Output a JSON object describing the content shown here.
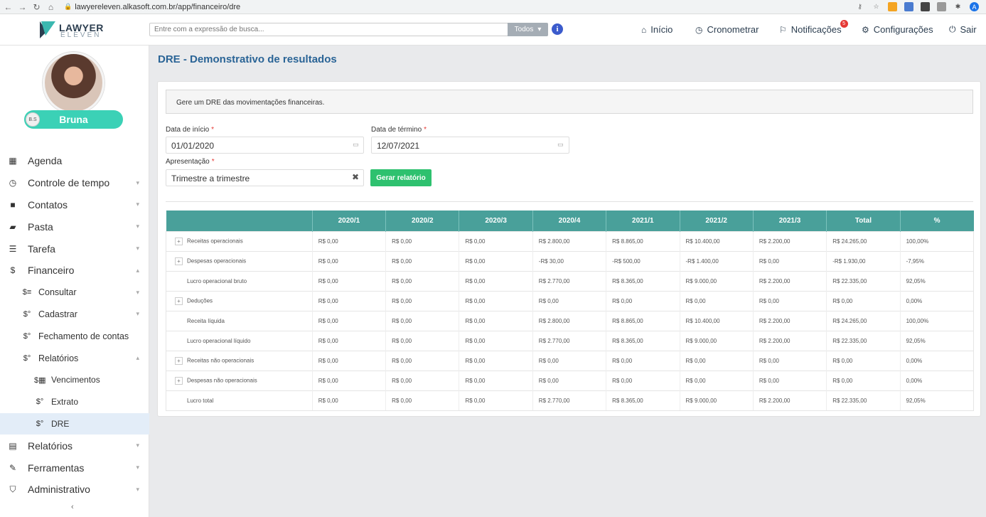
{
  "browser": {
    "url": "lawyereleven.alkasoft.com.br/app/financeiro/dre"
  },
  "header": {
    "logo_word": "LAWYER",
    "logo_sub": "ELEVEN",
    "search_placeholder": "Entre com a expressão de busca...",
    "search_filter": "Todos",
    "nav": {
      "inicio": "Início",
      "cronometrar": "Cronometrar",
      "notificacoes": "Notificações",
      "notificacoes_count": "5",
      "configuracoes": "Configurações",
      "sair": "Sair"
    }
  },
  "user": {
    "initials": "B.S",
    "name": "Bruna"
  },
  "sidebar": {
    "agenda": "Agenda",
    "controle_tempo": "Controle de tempo",
    "contatos": "Contatos",
    "pasta": "Pasta",
    "tarefa": "Tarefa",
    "financeiro": "Financeiro",
    "consultar": "Consultar",
    "cadastrar": "Cadastrar",
    "fechamento": "Fechamento de contas",
    "relatorios_sub": "Relatórios",
    "vencimentos": "Vencimentos",
    "extrato": "Extrato",
    "dre": "DRE",
    "relatorios": "Relatórios",
    "ferramentas": "Ferramentas",
    "administrativo": "Administrativo"
  },
  "page": {
    "title": "DRE - Demonstrativo de resultados",
    "description": "Gere um DRE das movimentações financeiras.",
    "start_label": "Data de início",
    "start_value": "01/01/2020",
    "end_label": "Data de término",
    "end_value": "12/07/2021",
    "presentation_label": "Apresentação",
    "presentation_value": "Trimestre a trimestre",
    "generate_button": "Gerar relatório"
  },
  "table": {
    "headers": [
      "",
      "2020/1",
      "2020/2",
      "2020/3",
      "2020/4",
      "2021/1",
      "2021/2",
      "2021/3",
      "Total",
      "%"
    ],
    "rows": [
      {
        "label": "Receitas operacionais",
        "expandable": true,
        "cells": [
          "R$ 0,00",
          "R$ 0,00",
          "R$ 0,00",
          "R$ 2.800,00",
          "R$ 8.865,00",
          "R$ 10.400,00",
          "R$ 2.200,00",
          "R$ 24.265,00",
          "100,00%"
        ],
        "negative": [
          false,
          false,
          false,
          false,
          false,
          false,
          false,
          false,
          false
        ]
      },
      {
        "label": "Despesas operacionais",
        "expandable": true,
        "cells": [
          "R$ 0,00",
          "R$ 0,00",
          "R$ 0,00",
          "-R$ 30,00",
          "-R$ 500,00",
          "-R$ 1.400,00",
          "R$ 0,00",
          "-R$ 1.930,00",
          "-7,95%"
        ],
        "negative": [
          false,
          false,
          false,
          true,
          true,
          true,
          false,
          true,
          true
        ]
      },
      {
        "label": "Lucro operacional bruto",
        "expandable": false,
        "cells": [
          "R$ 0,00",
          "R$ 0,00",
          "R$ 0,00",
          "R$ 2.770,00",
          "R$ 8.365,00",
          "R$ 9.000,00",
          "R$ 2.200,00",
          "R$ 22.335,00",
          "92,05%"
        ],
        "negative": [
          false,
          false,
          false,
          false,
          false,
          false,
          false,
          false,
          false
        ]
      },
      {
        "label": "Deduções",
        "expandable": true,
        "cells": [
          "R$ 0,00",
          "R$ 0,00",
          "R$ 0,00",
          "R$ 0,00",
          "R$ 0,00",
          "R$ 0,00",
          "R$ 0,00",
          "R$ 0,00",
          "0,00%"
        ],
        "negative": [
          false,
          false,
          false,
          false,
          false,
          false,
          false,
          false,
          false
        ]
      },
      {
        "label": "Receita líquida",
        "expandable": false,
        "cells": [
          "R$ 0,00",
          "R$ 0,00",
          "R$ 0,00",
          "R$ 2.800,00",
          "R$ 8.865,00",
          "R$ 10.400,00",
          "R$ 2.200,00",
          "R$ 24.265,00",
          "100,00%"
        ],
        "negative": [
          false,
          false,
          false,
          false,
          false,
          false,
          false,
          false,
          false
        ]
      },
      {
        "label": "Lucro operacional líquido",
        "expandable": false,
        "cells": [
          "R$ 0,00",
          "R$ 0,00",
          "R$ 0,00",
          "R$ 2.770,00",
          "R$ 8.365,00",
          "R$ 9.000,00",
          "R$ 2.200,00",
          "R$ 22.335,00",
          "92,05%"
        ],
        "negative": [
          false,
          false,
          false,
          false,
          false,
          false,
          false,
          false,
          false
        ]
      },
      {
        "label": "Receitas não operacionais",
        "expandable": true,
        "cells": [
          "R$ 0,00",
          "R$ 0,00",
          "R$ 0,00",
          "R$ 0,00",
          "R$ 0,00",
          "R$ 0,00",
          "R$ 0,00",
          "R$ 0,00",
          "0,00%"
        ],
        "negative": [
          false,
          false,
          false,
          false,
          false,
          false,
          false,
          false,
          false
        ]
      },
      {
        "label": "Despesas não operacionais",
        "expandable": true,
        "cells": [
          "R$ 0,00",
          "R$ 0,00",
          "R$ 0,00",
          "R$ 0,00",
          "R$ 0,00",
          "R$ 0,00",
          "R$ 0,00",
          "R$ 0,00",
          "0,00%"
        ],
        "negative": [
          false,
          false,
          false,
          false,
          false,
          false,
          false,
          false,
          false
        ]
      },
      {
        "label": "Lucro total",
        "expandable": false,
        "cells": [
          "R$ 0,00",
          "R$ 0,00",
          "R$ 0,00",
          "R$ 2.770,00",
          "R$ 8.365,00",
          "R$ 9.000,00",
          "R$ 2.200,00",
          "R$ 22.335,00",
          "92,05%"
        ],
        "negative": [
          false,
          false,
          false,
          false,
          false,
          false,
          false,
          false,
          false
        ]
      }
    ]
  },
  "colors": {
    "accent": "#49a09a",
    "title": "#2a6496",
    "user_pill": "#3bd1b6",
    "button": "#2ec16f",
    "negative": "#e53935"
  }
}
